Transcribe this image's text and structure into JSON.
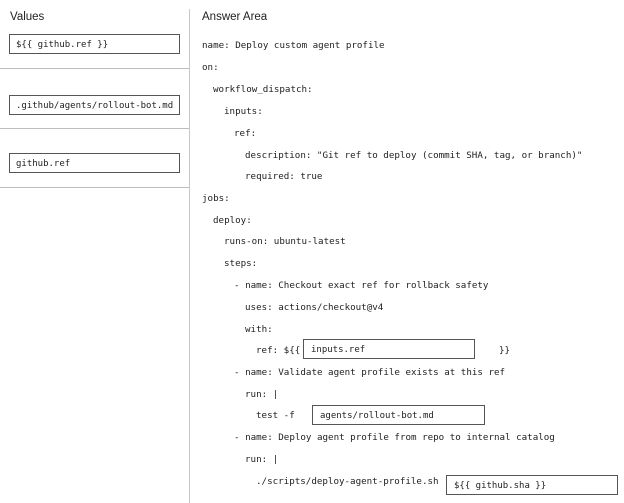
{
  "values_panel": {
    "heading": "Values",
    "items": [
      "${{ github.ref }}",
      ".github/agents/rollout-bot.md",
      "github.ref"
    ]
  },
  "answer_area": {
    "heading": "Answer Area",
    "lines": {
      "name": "name: Deploy custom agent profile",
      "on": "on:",
      "workflow_dispatch": "workflow_dispatch:",
      "inputs": "inputs:",
      "ref": "ref:",
      "description": "description: \"Git ref to deploy (commit SHA, tag, or branch)\"",
      "required": "required: true",
      "jobs": "jobs:",
      "deploy": "deploy:",
      "runs_on": "runs-on: ubuntu-latest",
      "steps": "steps:",
      "step1_name": "- name: Checkout exact ref for rollback safety",
      "step1_uses": "uses: actions/checkout@v4",
      "step1_with": "with:",
      "step1_ref_prefix": "ref: ${{",
      "step1_ref_suffix": "}}",
      "step2_name": "- name: Validate agent profile exists at this ref",
      "step2_run": "run: |",
      "step2_test": "test -f",
      "step3_name": "- name: Deploy agent profile from repo to internal catalog",
      "step3_run": "run: |",
      "step3_script": "./scripts/deploy-agent-profile.sh"
    },
    "drop_targets": {
      "ref_slot": "inputs.ref",
      "test_slot": "agents/rollout-bot.md",
      "script_slot": "${{ github.sha }}"
    }
  }
}
